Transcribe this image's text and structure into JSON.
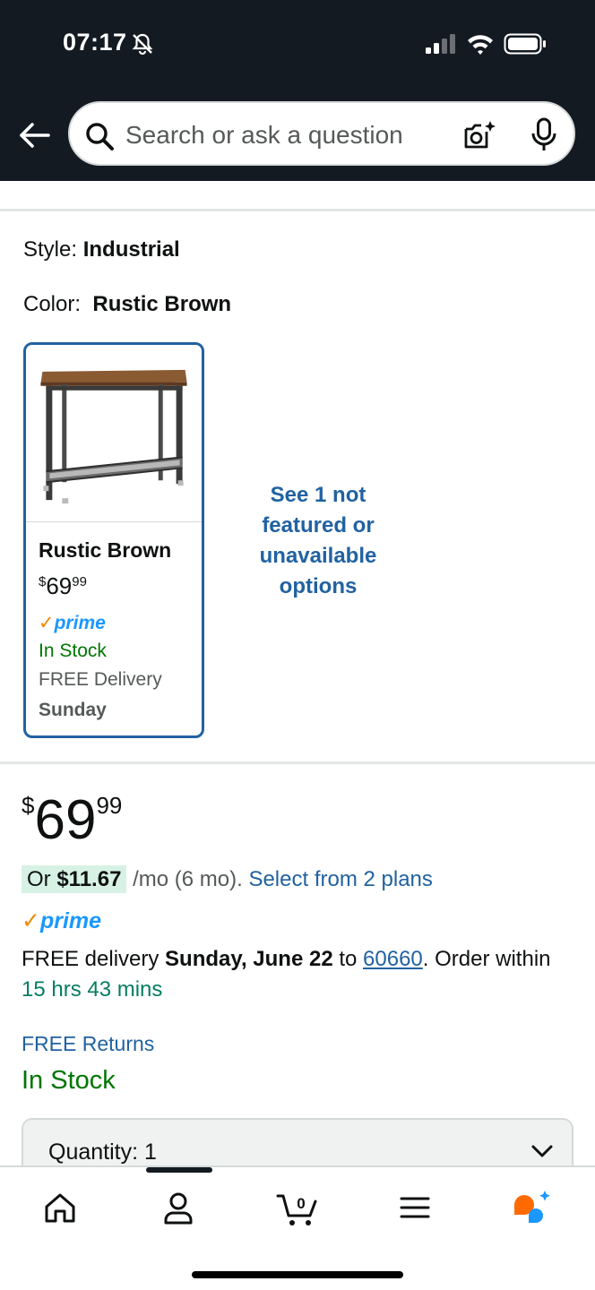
{
  "status_bar": {
    "time": "07:17"
  },
  "search": {
    "placeholder": "Search or ask a question"
  },
  "product": {
    "style_label": "Style:",
    "style_value": "Industrial",
    "color_label": "Color:",
    "color_value": "Rustic Brown"
  },
  "variant": {
    "name": "Rustic Brown",
    "price_currency": "$",
    "price_whole": "69",
    "price_fraction": "99",
    "prime_check": "✓",
    "prime_label": "prime",
    "stock": "In Stock",
    "delivery": "FREE Delivery",
    "delivery_day": "Sunday"
  },
  "see_more": "See 1 not featured or unavailable options",
  "price": {
    "currency": "$",
    "whole": "69",
    "fraction": "99"
  },
  "monthly": {
    "prefix": "Or ",
    "amount": "$11.67",
    "suffix": " /mo (6 mo). ",
    "link": "Select from 2 plans"
  },
  "prime": {
    "check": "✓",
    "label": "prime"
  },
  "delivery": {
    "prefix": "FREE delivery ",
    "date": "Sunday, June 22",
    "to": " to ",
    "zip": "60660",
    "order": ". Order within ",
    "countdown": "15 hrs 43 mins"
  },
  "returns": "FREE Returns",
  "stock": "In Stock",
  "quantity": {
    "label": "Quantity: 1"
  },
  "nav": {
    "cart_count": "0"
  },
  "colors": {
    "header_bg": "#131a22",
    "link": "#2162a1",
    "in_stock": "#007600",
    "prime_blue": "#1a98ff",
    "prime_check": "#f08804",
    "selected_border": "#2162a1"
  }
}
